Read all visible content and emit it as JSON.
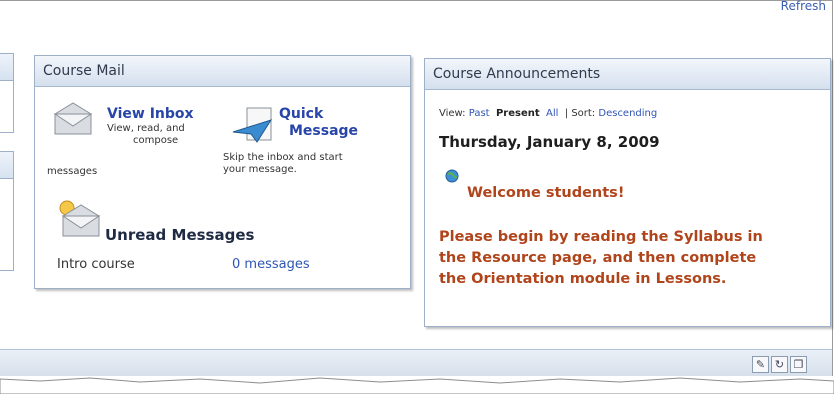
{
  "header": {
    "refresh_label": "Refresh"
  },
  "course_mail": {
    "title": "Course Mail",
    "view_inbox": {
      "label": "View Inbox",
      "desc_line1": "View, read, and",
      "desc_line2": "compose",
      "desc_line3": "messages"
    },
    "quick_message": {
      "label_line1": "Quick",
      "label_line2": "Message",
      "desc_line1": "Skip the inbox and start",
      "desc_line2": "your message."
    },
    "unread": {
      "label": "Unread Messages",
      "course": "Intro course",
      "count": "0 messages"
    }
  },
  "announcements": {
    "title": "Course Announcements",
    "view_label": "View:",
    "view_past": "Past",
    "view_present": "Present",
    "view_all": "All",
    "sort_label": "| Sort:",
    "sort_value": "Descending",
    "date": "Thursday, January 8, 2009",
    "headline": "Welcome students!",
    "body_line1": "Please begin by reading the Syllabus in",
    "body_line2": "the Resource page, and then complete",
    "body_line3": "the Orientation module in Lessons."
  },
  "colors": {
    "link": "#2845a8",
    "announcement": "#b0441b",
    "panel_border": "#9db0c8"
  }
}
